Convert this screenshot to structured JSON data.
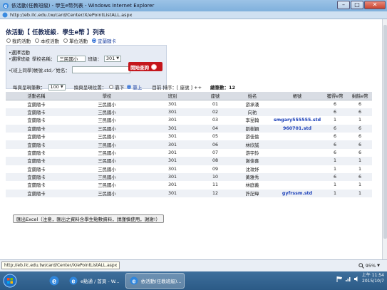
{
  "window": {
    "title": "依活動(任教班級) - 學生e幣列表 - Windows Internet Explorer",
    "url": "http://eb.ilc.edu.tw/card/Center/X/ePointListALL.aspx"
  },
  "page": {
    "title": "依活動【 任教班級．學生e幣 】列表",
    "radios": [
      {
        "label": "我的活動",
        "checked": false
      },
      {
        "label": "本校活動",
        "checked": false
      },
      {
        "label": "單位活動",
        "checked": false
      },
      {
        "label": "宜蘭隨卡",
        "checked": true
      }
    ],
    "filter": {
      "activity_label": "•選擇活動",
      "class_label": "•選擇班級",
      "school_label": "學校名稱：",
      "school_value": "三民國小",
      "class_num_label": "班級：",
      "class_value": "301",
      "search_label": "•[班上同學]帳號.std／姓名：",
      "search_value": "",
      "query_button": "開始查詢"
    },
    "pager": {
      "per_page_label": "每頁呈現筆數：",
      "per_page_value": "100",
      "order_label": "換頁呈現位置：",
      "order_options": [
        {
          "label": "靠下",
          "checked": false
        },
        {
          "label": "靠上",
          "checked": true
        }
      ],
      "sort_label": "目前 排序：[ 座號 ] ++",
      "total_label": "總筆數：12"
    },
    "table": {
      "headers": [
        "活動名稱",
        "學校",
        "班別",
        "座號",
        "姓名",
        "帳號",
        "獲得e幣",
        "剩餘e幣"
      ],
      "rows": [
        [
          "宜蘭隨卡",
          "三民國小",
          "301",
          "01",
          "游承漢",
          "",
          "6",
          "6"
        ],
        [
          "宜蘭隨卡",
          "三民國小",
          "301",
          "02",
          "向祐",
          "",
          "6",
          "6"
        ],
        [
          "宜蘭隨卡",
          "三民國小",
          "301",
          "03",
          "李昆翰",
          "smgary555555.std",
          "1",
          "1"
        ],
        [
          "宜蘭隨卡",
          "三民國小",
          "301",
          "04",
          "劉樹穎",
          "960701.std",
          "6",
          "6"
        ],
        [
          "宜蘭隨卡",
          "三民國小",
          "301",
          "05",
          "游佳倫",
          "",
          "6",
          "6"
        ],
        [
          "宜蘭隨卡",
          "三民國小",
          "301",
          "06",
          "林欣誠",
          "",
          "6",
          "6"
        ],
        [
          "宜蘭隨卡",
          "三民國小",
          "301",
          "07",
          "游宇鈴",
          "",
          "6",
          "6"
        ],
        [
          "宜蘭隨卡",
          "三民國小",
          "301",
          "08",
          "謝佳喜",
          "",
          "1",
          "1"
        ],
        [
          "宜蘭隨卡",
          "三民國小",
          "301",
          "09",
          "沈玟妤",
          "",
          "1",
          "1"
        ],
        [
          "宜蘭隨卡",
          "三民國小",
          "301",
          "10",
          "黃雅秀",
          "",
          "6",
          "6"
        ],
        [
          "宜蘭隨卡",
          "三民國小",
          "301",
          "11",
          "林庭義",
          "",
          "1",
          "1"
        ],
        [
          "宜蘭隨卡",
          "三民國小",
          "301",
          "12",
          "許記瑋",
          "gyfrssm.std",
          "1",
          "1"
        ]
      ]
    },
    "export_button": "匯出Excel（注意，匯出之資料含學生點數資料，請謹慎使用，謝謝!）"
  },
  "status": {
    "url": "http://eb.ilc.edu.tw/card/Center/X/ePointListALL.aspx",
    "zoom": "95%"
  },
  "taskbar": {
    "apps": [
      {
        "label": "e點通 / 首頁 - W...",
        "active": false
      },
      {
        "label": "依活動(任教班級)...",
        "active": true
      }
    ],
    "time": "上午 11:54",
    "date": "2015/10/7"
  },
  "colors": {
    "accent": "#1a3fb8",
    "query_button": "#c4161c",
    "header_row": "#d9dde4",
    "alt_row": "#eef1f6"
  }
}
